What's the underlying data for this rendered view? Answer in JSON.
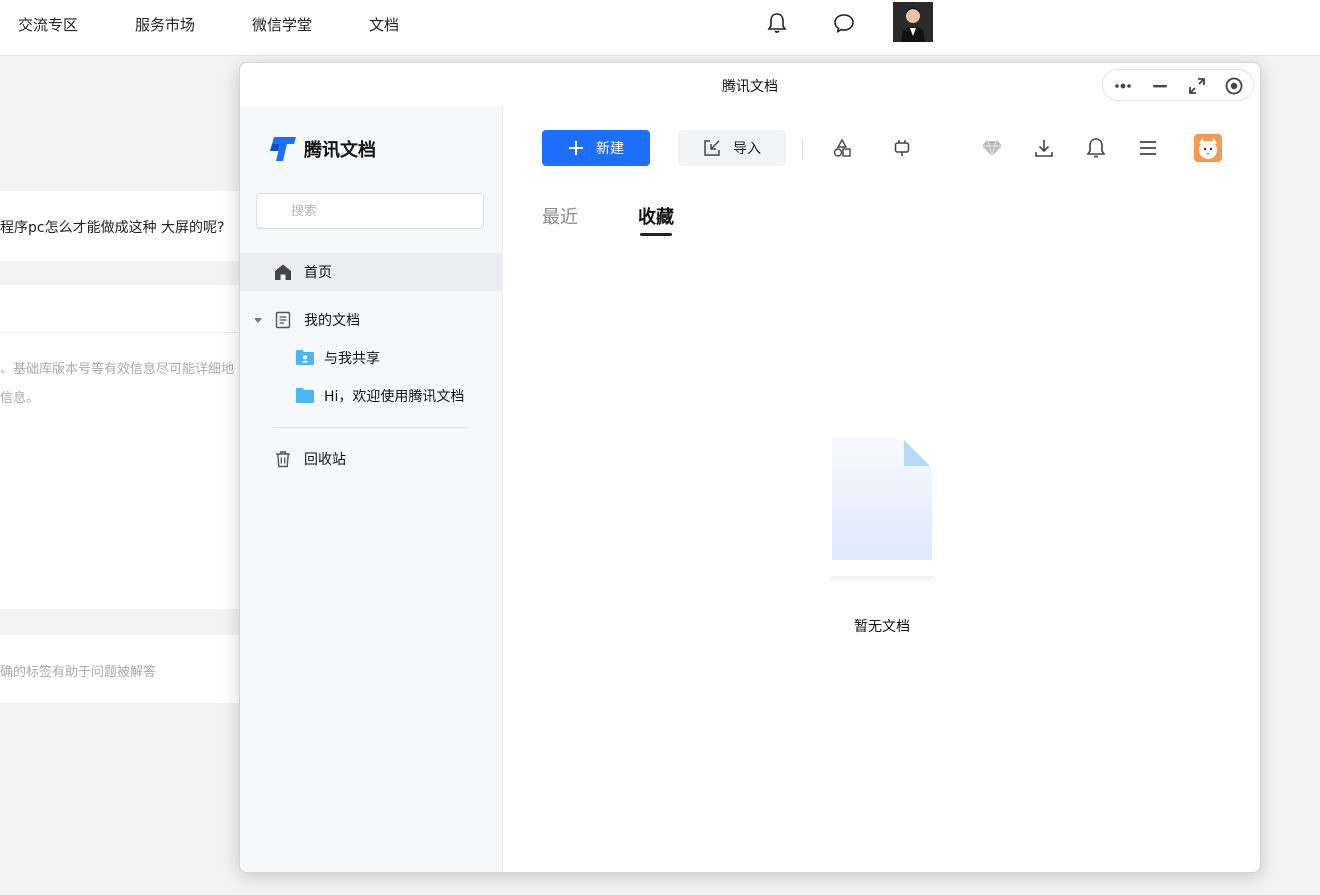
{
  "site": {
    "nav_items": [
      "交流专区",
      "服务市场",
      "微信学堂",
      "文档"
    ],
    "question_line": "程序pc怎么才能做成这种 大屏的呢?",
    "hint_line1": "、基础库版本号等有效信息尽可能详细地",
    "hint_line2": "信息。",
    "tag_hint": "确的标签有助于问题被解答"
  },
  "window": {
    "title": "腾讯文档"
  },
  "sidebar": {
    "logo_text": "腾讯文档",
    "search_placeholder": "搜索",
    "home": "首页",
    "my_docs": "我的文档",
    "shared": "与我共享",
    "welcome": "Hi，欢迎使用腾讯文档",
    "trash": "回收站"
  },
  "toolbar": {
    "new_label": "新建",
    "import_label": "导入"
  },
  "tabs": {
    "recent": "最近",
    "favorites": "收藏",
    "active": "favorites"
  },
  "empty": {
    "text": "暂无文档"
  },
  "colors": {
    "primary": "#1e6fff",
    "folder": "#4cb7f5",
    "sidebar_bg": "#f7f8fa"
  }
}
